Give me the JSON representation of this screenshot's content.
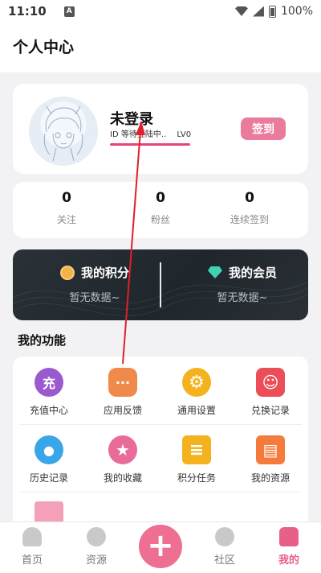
{
  "statusbar": {
    "time": "11:10",
    "notif_icon": "A",
    "battery": "100%"
  },
  "header": {
    "title": "个人中心"
  },
  "profile": {
    "name": "未登录",
    "id_prefix": "ID",
    "status": "等待登陆中..",
    "level": "LV0",
    "signin_label": "签到",
    "avatar_icon": "anime-girl-sketch-icon"
  },
  "stats": [
    {
      "value": "0",
      "label": "关注"
    },
    {
      "value": "0",
      "label": "粉丝"
    },
    {
      "value": "0",
      "label": "连续签到"
    }
  ],
  "vip": {
    "points": {
      "title": "我的积分",
      "sub": "暂无数据~",
      "icon": "coin-icon"
    },
    "member": {
      "title": "我的会员",
      "sub": "暂无数据~",
      "icon": "diamond-icon"
    }
  },
  "functions": {
    "title": "我的功能",
    "items": [
      {
        "label": "充值中心",
        "glyph": "充",
        "color": "#9b59d0"
      },
      {
        "label": "应用反馈",
        "glyph": "···",
        "color": "#f08a4b"
      },
      {
        "label": "通用设置",
        "glyph": "⚙",
        "color": "#f5b21f"
      },
      {
        "label": "兑换记录",
        "glyph": "☺",
        "color": "#ec4e58"
      },
      {
        "label": "历史记录",
        "glyph": "●",
        "color": "#3aa6ea"
      },
      {
        "label": "我的收藏",
        "glyph": "★",
        "color": "#e96b9a"
      },
      {
        "label": "积分任务",
        "glyph": "≡",
        "color": "#f5b21f"
      },
      {
        "label": "我的资源",
        "glyph": "▤",
        "color": "#f57b3c"
      }
    ]
  },
  "tabbar": {
    "items": [
      {
        "label": "首页"
      },
      {
        "label": "资源"
      },
      {
        "label": "社区"
      },
      {
        "label": "我的"
      }
    ],
    "plus": "+"
  },
  "colors": {
    "accent": "#e8608a",
    "annotation": "#e0202a"
  }
}
